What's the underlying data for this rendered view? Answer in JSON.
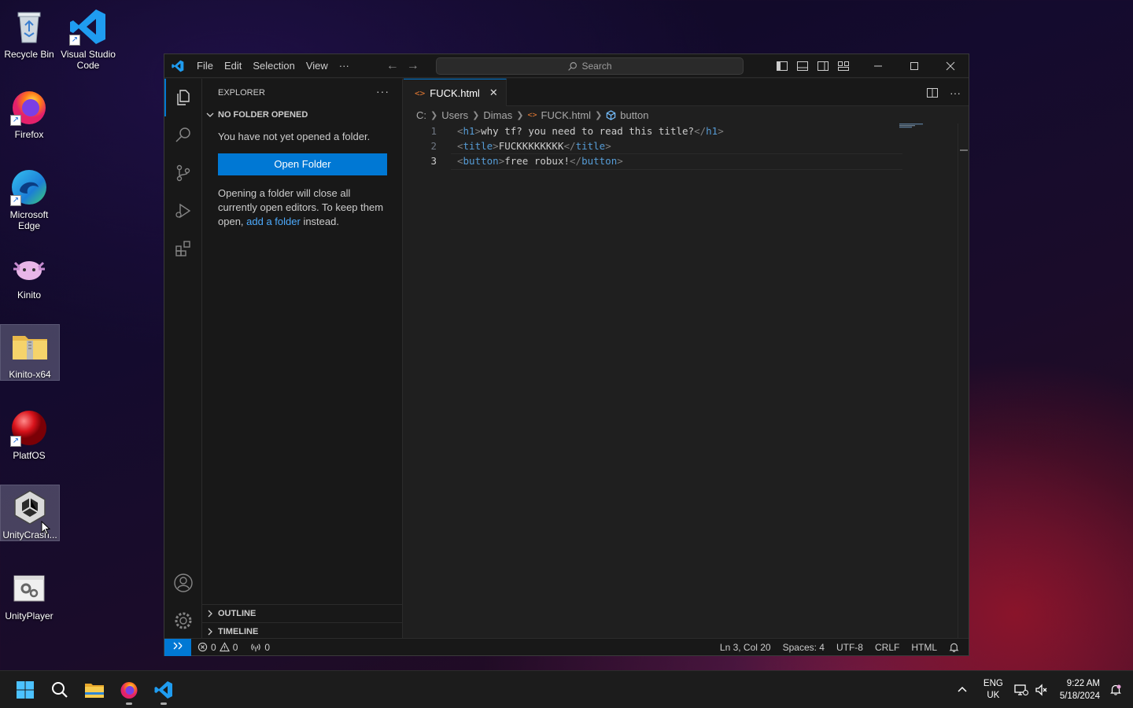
{
  "desktop": {
    "icons": [
      {
        "label": "Recycle Bin"
      },
      {
        "label": "Visual Studio Code"
      },
      {
        "label": "Firefox"
      },
      {
        "label": "Microsoft Edge"
      },
      {
        "label": "Kinito"
      },
      {
        "label": "Kinito-x64"
      },
      {
        "label": "PlatfOS"
      },
      {
        "label": "UnityCrash..."
      },
      {
        "label": "UnityPlayer"
      }
    ]
  },
  "vscode": {
    "menu": [
      "File",
      "Edit",
      "Selection",
      "View",
      "···"
    ],
    "search_placeholder": "Search",
    "explorer": {
      "header": "EXPLORER",
      "more": "···",
      "section": "NO FOLDER OPENED",
      "message": "You have not yet opened a folder.",
      "open_folder_button": "Open Folder",
      "info_before": "Opening a folder will close all currently open editors. To keep them open, ",
      "info_link": "add a folder",
      "info_after": " instead.",
      "outline": "OUTLINE",
      "timeline": "TIMELINE"
    },
    "tab": {
      "filename": "FUCK.html",
      "close": "✕"
    },
    "breadcrumb": [
      "C:",
      "Users",
      "Dimas",
      "FUCK.html",
      "button"
    ],
    "code_lines": [
      {
        "num": "1",
        "open": "h1",
        "text": "why tf? you need to read this title?",
        "close": "h1"
      },
      {
        "num": "2",
        "open": "title",
        "text": "FUCKKKKKKKK",
        "close": "title"
      },
      {
        "num": "3",
        "open": "button",
        "text": "free robux!",
        "close": "button"
      }
    ],
    "status": {
      "errors": "0",
      "warnings": "0",
      "ports": "0",
      "cursor": "Ln 3, Col 20",
      "spaces": "Spaces: 4",
      "encoding": "UTF-8",
      "eol": "CRLF",
      "language": "HTML"
    },
    "colors": {
      "accent": "#0078d4",
      "tag": "#569cd6",
      "bracket": "#808080"
    }
  },
  "taskbar": {
    "lang_top": "ENG",
    "lang_bottom": "UK",
    "time": "9:22 AM",
    "date": "5/18/2024"
  }
}
